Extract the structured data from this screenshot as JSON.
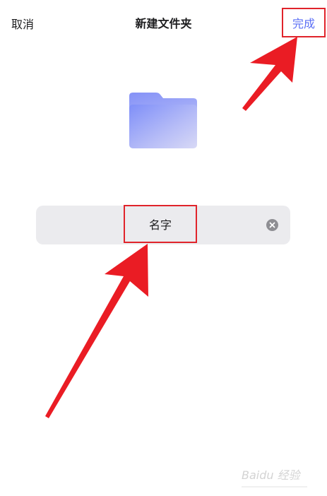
{
  "header": {
    "cancel_label": "取消",
    "title": "新建文件夹",
    "done_label": "完成"
  },
  "name_field": {
    "value": "名字"
  },
  "icons": {
    "folder": "folder-icon",
    "clear": "clear-icon",
    "watermark": "baidu-jingyan-watermark-icon"
  },
  "colors": {
    "accent": "#5b6ff5",
    "annotation_red": "#e0242b",
    "field_bg": "#ebebee"
  },
  "watermark": {
    "text": "Baidu 经验"
  }
}
